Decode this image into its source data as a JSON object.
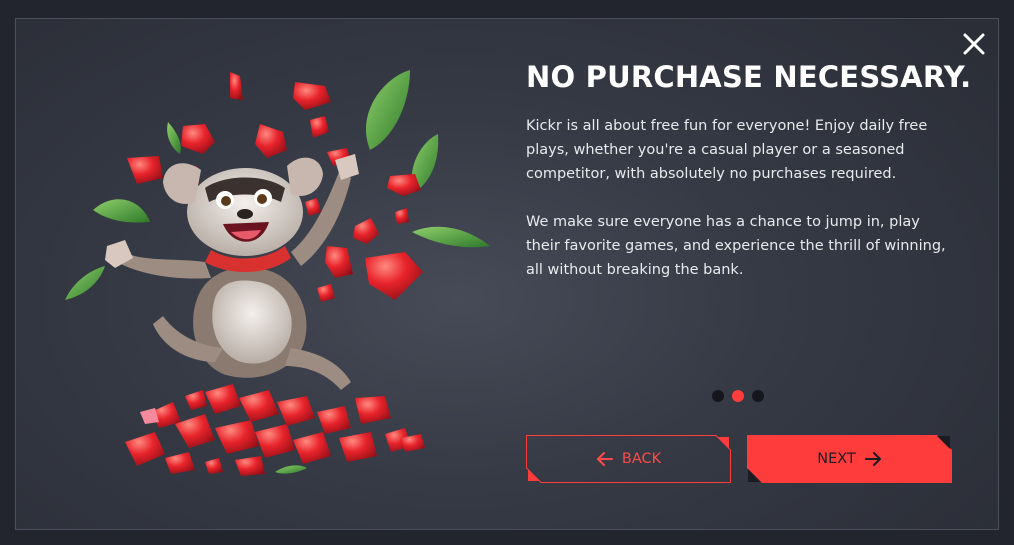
{
  "modal": {
    "title": "NO PURCHASE NECESSARY.",
    "paragraphs": [
      "Kickr is all about free fun for everyone! Enjoy daily free plays, whether you're a casual player or a seasoned competitor, with absolutely no purchases required.",
      "We make sure everyone has a chance to jump in, play their favorite games, and experience the thrill of winning, all without breaking the bank."
    ],
    "carousel": {
      "total_slides": 3,
      "current_slide": 2
    },
    "buttons": {
      "back_label": "BACK",
      "next_label": "NEXT"
    },
    "icons": {
      "close": "close-icon",
      "back": "arrow-left-icon",
      "next": "arrow-right-icon",
      "illustration": "raccoon-with-gems-illustration"
    },
    "colors": {
      "accent": "#ff3c3c",
      "background": "#2b2e37",
      "text": "#e9eaee",
      "dot_inactive": "#14161b"
    }
  }
}
